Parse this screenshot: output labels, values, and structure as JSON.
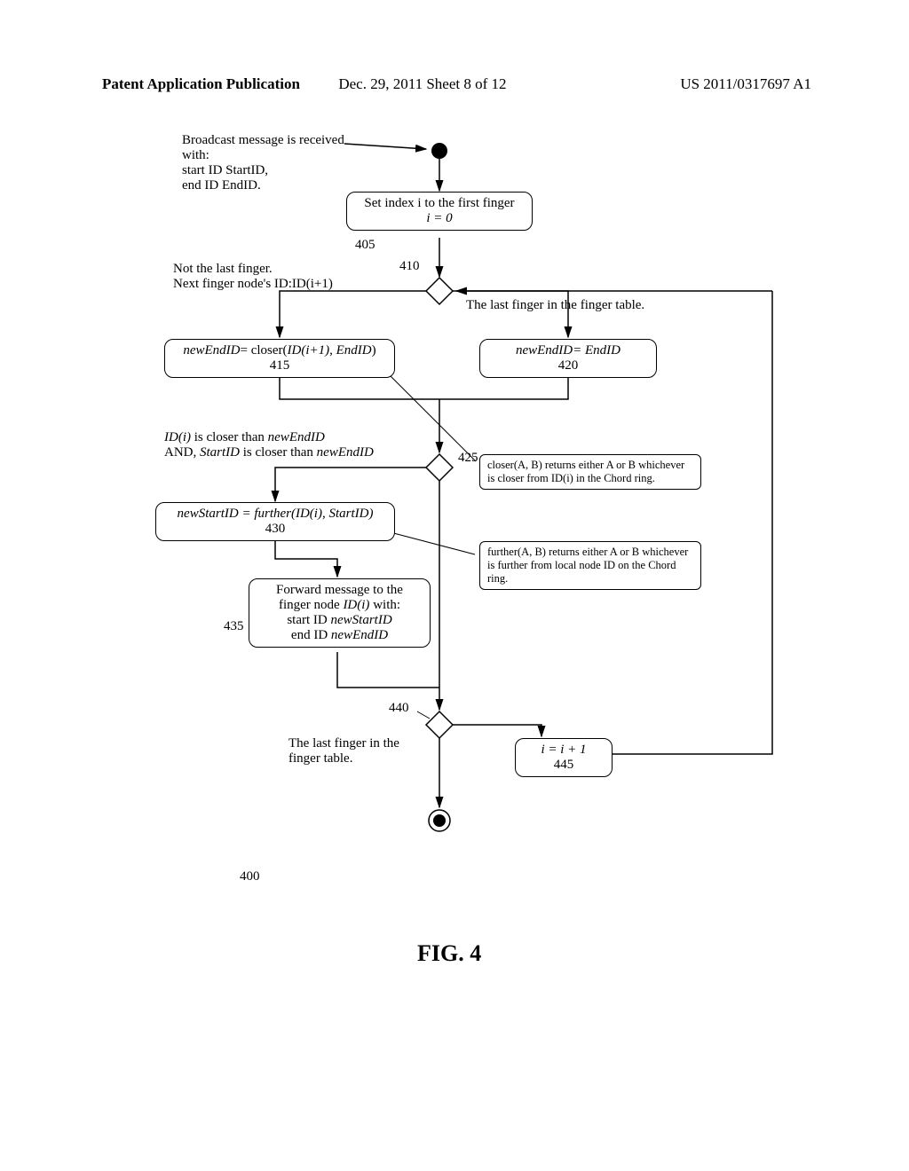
{
  "header": {
    "left": "Patent Application Publication",
    "center": "Dec. 29, 2011  Sheet 8 of 12",
    "right": "US 2011/0317697 A1"
  },
  "labels": {
    "start_block": "Broadcast message is received with:\nstart ID StartID,\nend ID EndID.",
    "box_405": "Set index i to the first finger",
    "box_405_code": "i = 0",
    "ref_405": "405",
    "ref_410": "410",
    "left_410": "Not the last finger.\nNext finger node's ID:ID(i+1)",
    "right_410": "The last finger in the finger table.",
    "box_415": "newEndID= closer(ID(i+1), EndID)",
    "ref_415": "415",
    "box_420": "newEndID= EndID",
    "ref_420": "420",
    "cond_425_line1": "ID(i) is closer than newEndID",
    "cond_425_line2": "AND, StartID is closer than newEndID",
    "ref_425": "425",
    "note_closer": "closer(A, B) returns either A or B whichever is closer from ID(i) in the Chord ring.",
    "box_430": "newStartID = further(ID(i), StartID)",
    "ref_430": "430",
    "note_further": "further(A, B) returns either A or B whichever is further from local node ID on the Chord ring.",
    "box_435": "Forward message to the finger node ID(i) with:\nstart ID newStartID\nend ID newEndID",
    "ref_435": "435",
    "ref_440": "440",
    "left_440": "The last finger in the finger table.",
    "box_445": "i = i + 1",
    "ref_445": "445",
    "ref_400": "400",
    "fig": "FIG. 4"
  }
}
